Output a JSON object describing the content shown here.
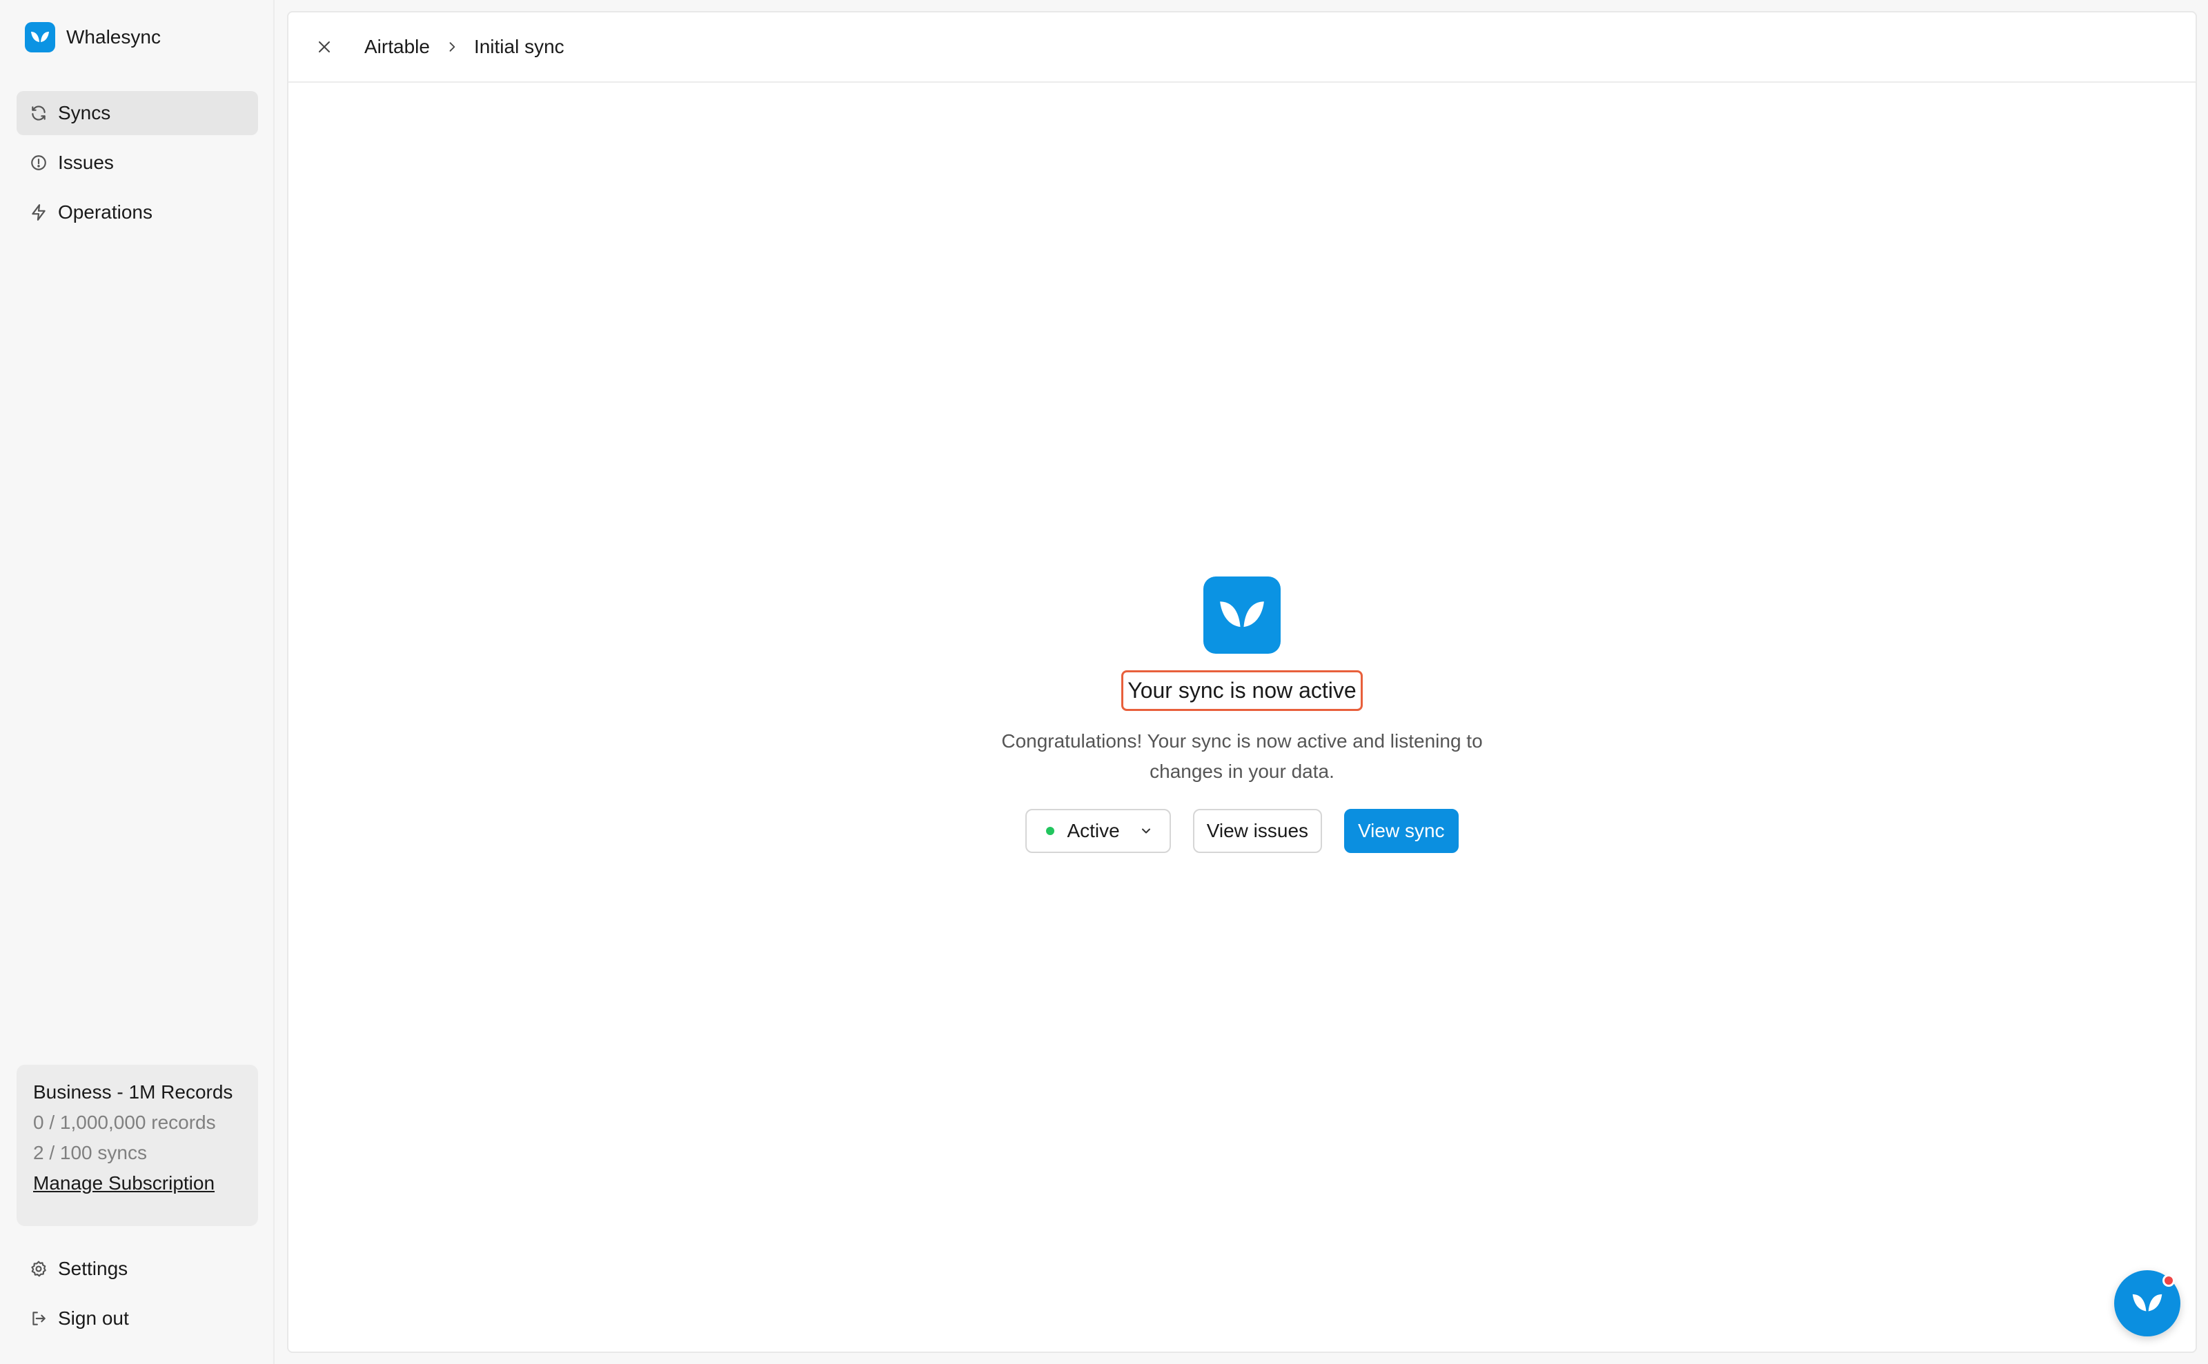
{
  "app": {
    "name": "Whalesync"
  },
  "sidebar": {
    "items": [
      {
        "label": "Syncs",
        "icon": "refresh-icon",
        "active": true
      },
      {
        "label": "Issues",
        "icon": "alert-circle-icon",
        "active": false
      },
      {
        "label": "Operations",
        "icon": "lightning-icon",
        "active": false
      }
    ],
    "plan": {
      "title": "Business - 1M Records",
      "records": "0 / 1,000,000 records",
      "syncs": "2 / 100 syncs",
      "manage_label": "Manage Subscription"
    },
    "bottom_items": [
      {
        "label": "Settings",
        "icon": "gear-icon"
      },
      {
        "label": "Sign out",
        "icon": "sign-out-icon"
      }
    ]
  },
  "header": {
    "breadcrumb": [
      "Airtable",
      "Initial sync"
    ]
  },
  "main": {
    "title": "Your sync is now active",
    "description": "Congratulations! Your sync is now active and listening to changes in your data.",
    "status_select": "Active",
    "view_issues_label": "View issues",
    "view_sync_label": "View sync"
  },
  "colors": {
    "brand": "#0b93e3",
    "status_active": "#22c55e",
    "highlight_border": "#e8603c",
    "notification_dot": "#ef4444"
  }
}
